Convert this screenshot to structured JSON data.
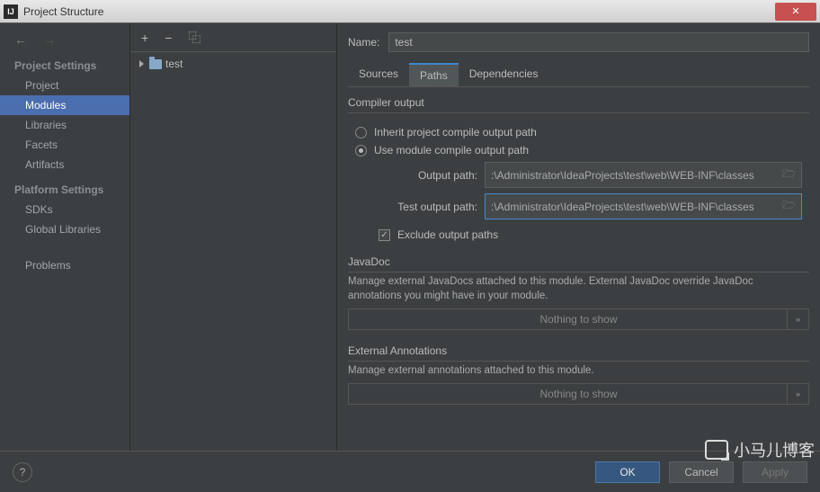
{
  "titlebar": {
    "title": "Project Structure",
    "close_glyph": "✕"
  },
  "nav": {
    "back_glyph": "←",
    "fwd_glyph": "→",
    "head1": "Project Settings",
    "items1": [
      "Project",
      "Modules",
      "Libraries",
      "Facets",
      "Artifacts"
    ],
    "head2": "Platform Settings",
    "items2": [
      "SDKs",
      "Global Libraries"
    ],
    "problems": "Problems"
  },
  "mid": {
    "add_glyph": "+",
    "remove_glyph": "−",
    "copy_glyph": "⿻",
    "tree_item": "test"
  },
  "right": {
    "name_label": "Name:",
    "name_value": "test",
    "tabs": [
      "Sources",
      "Paths",
      "Dependencies"
    ],
    "compiler_output": "Compiler output",
    "inherit": "Inherit project compile output path",
    "use_module": "Use module compile output path",
    "output_path_label": "Output path:",
    "output_path_value": ":\\Administrator\\IdeaProjects\\test\\web\\WEB-INF\\classes",
    "test_output_label": "Test output path:",
    "test_output_value": ":\\Administrator\\IdeaProjects\\test\\web\\WEB-INF\\classes",
    "exclude": "Exclude output paths",
    "javadoc_head": "JavaDoc",
    "javadoc_desc": "Manage external JavaDocs attached to this module. External JavaDoc override JavaDoc annotations you might have in your module.",
    "nothing": "Nothing to show",
    "ext_head": "External Annotations",
    "ext_desc": "Manage external annotations attached to this module."
  },
  "footer": {
    "help_glyph": "?",
    "ok": "OK",
    "cancel": "Cancel",
    "apply": "Apply"
  },
  "watermark": "小马儿博客"
}
